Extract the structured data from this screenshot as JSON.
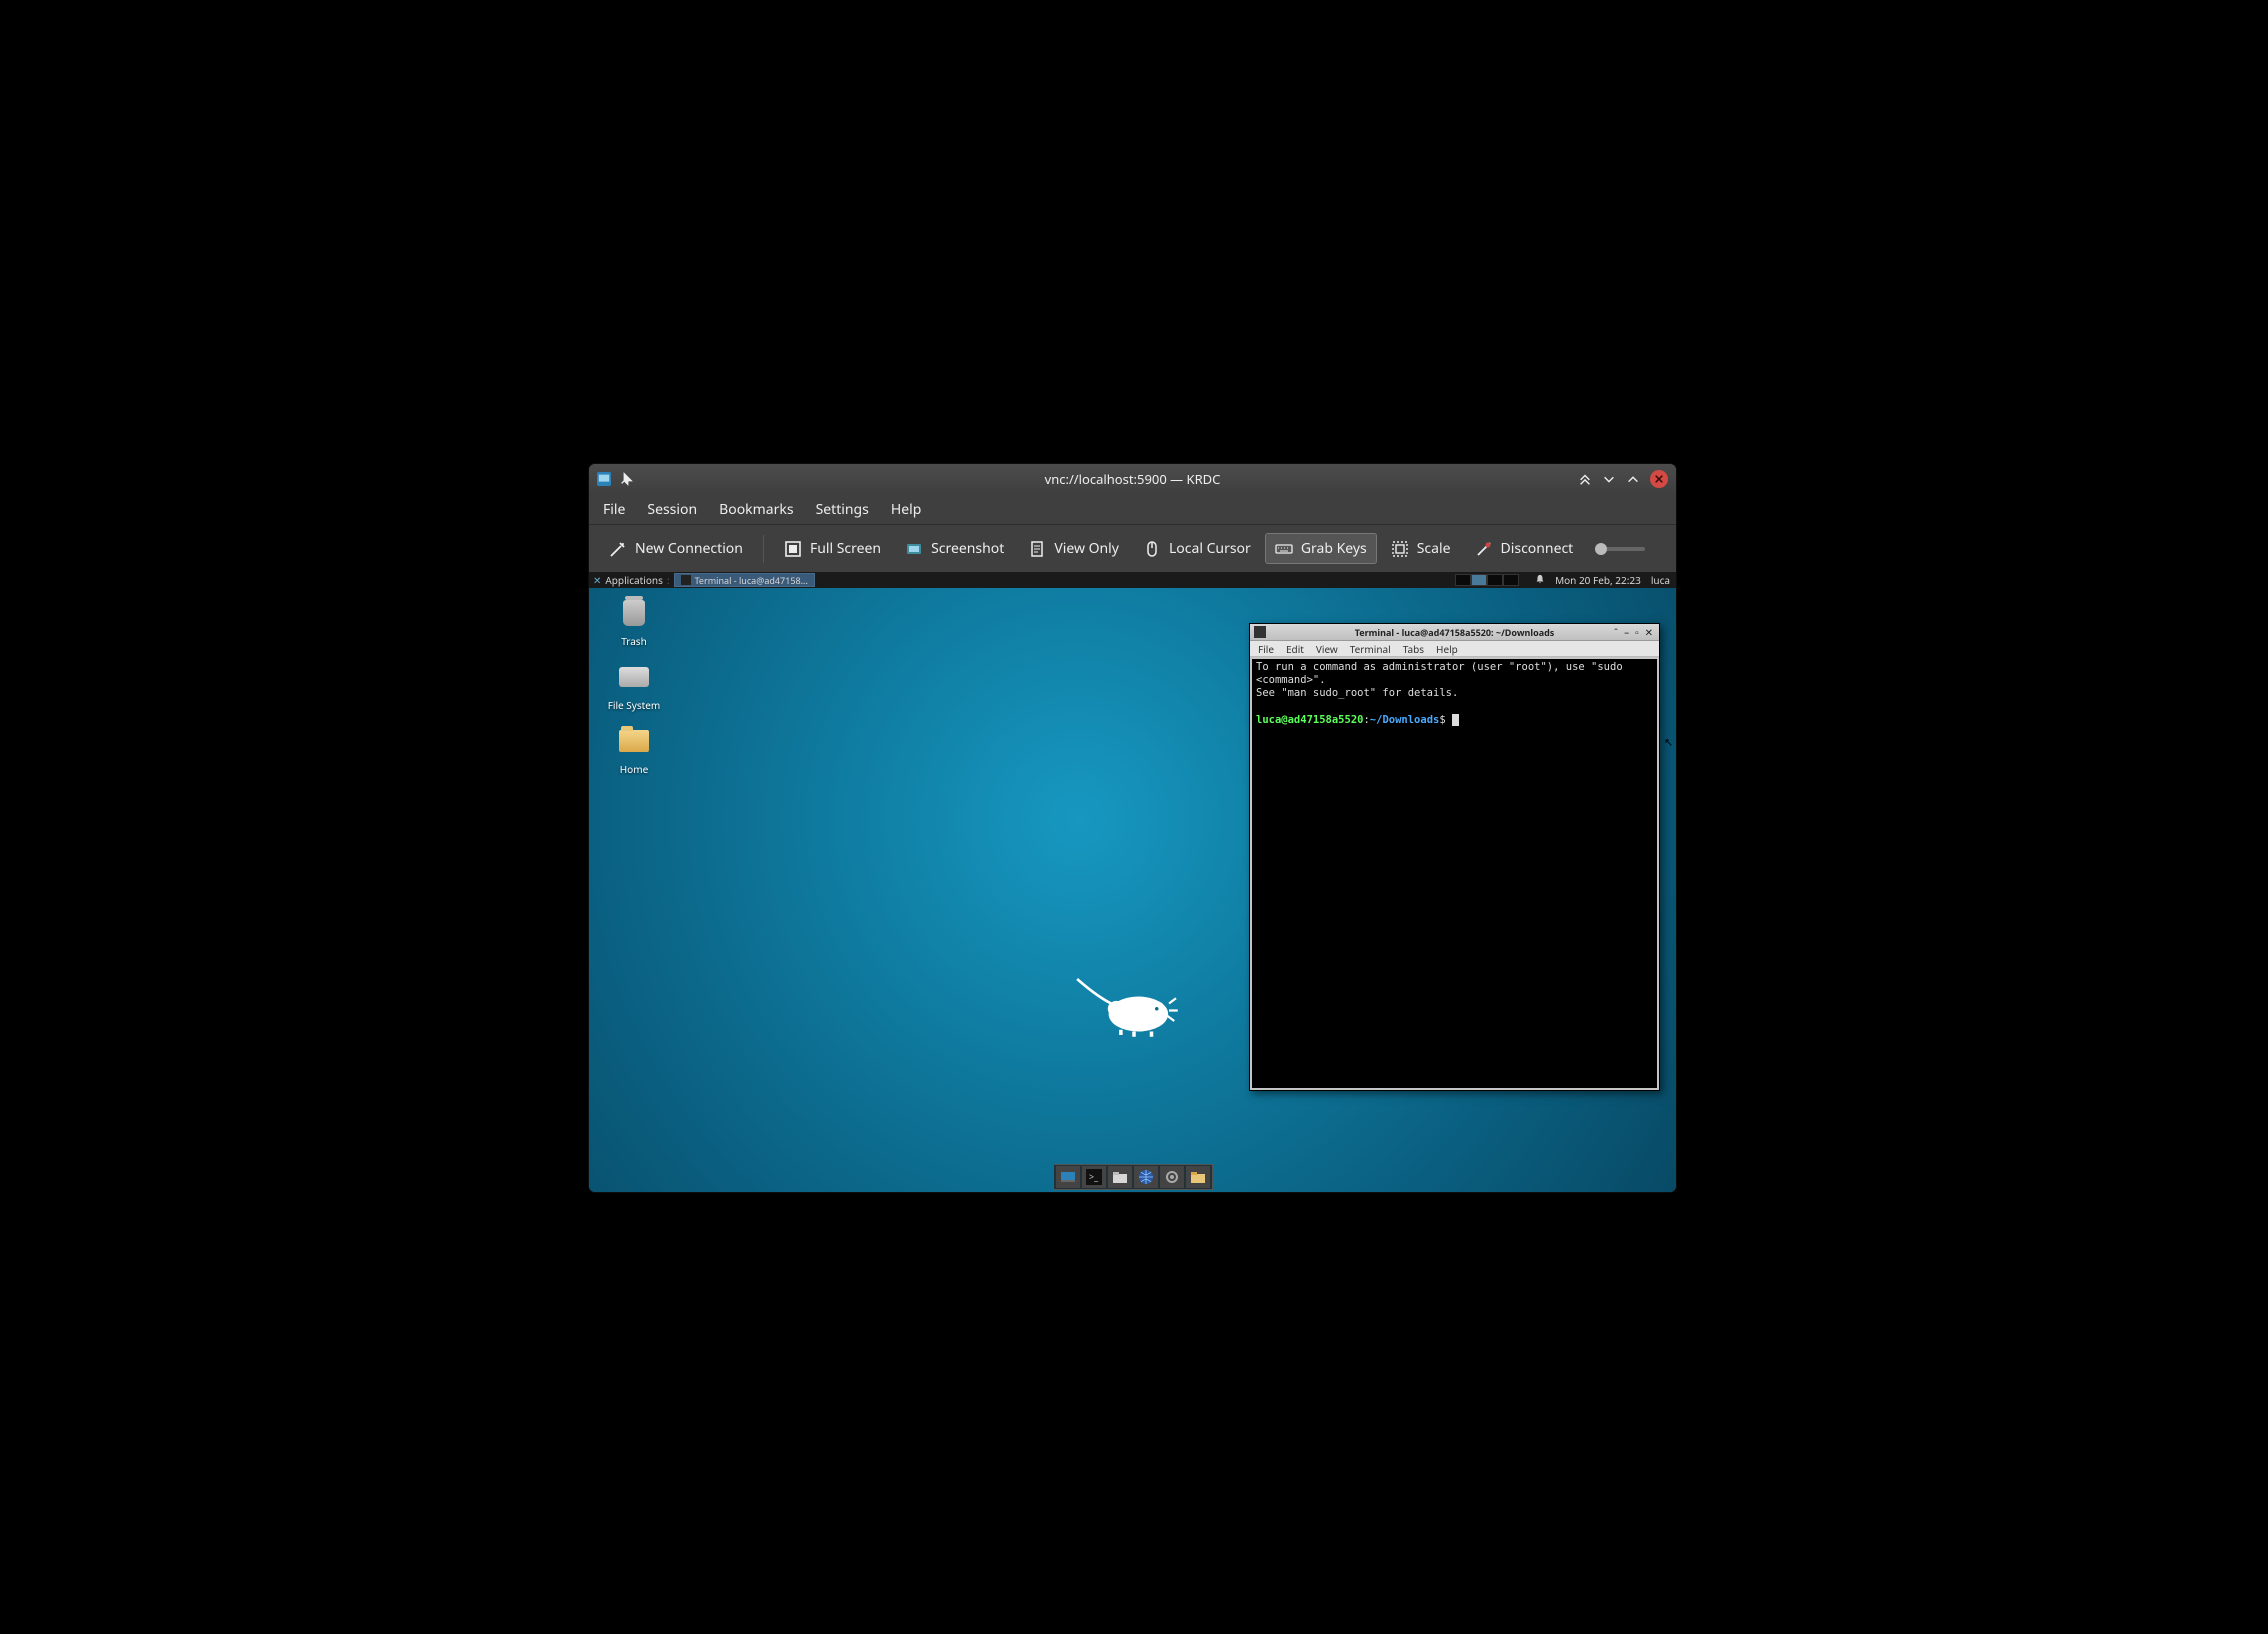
{
  "krdc": {
    "title": "vnc://localhost:5900 — KRDC",
    "menubar": [
      "File",
      "Session",
      "Bookmarks",
      "Settings",
      "Help"
    ],
    "toolbar": {
      "new_connection": "New Connection",
      "full_screen": "Full Screen",
      "screenshot": "Screenshot",
      "view_only": "View Only",
      "local_cursor": "Local Cursor",
      "grab_keys": "Grab Keys",
      "scale": "Scale",
      "disconnect": "Disconnect"
    }
  },
  "xfce": {
    "applications_label": "Applications",
    "taskbar_item": "Terminal - luca@ad47158...",
    "clock": "Mon 20 Feb, 22:23",
    "user": "luca",
    "desktop_icons": {
      "trash": "Trash",
      "filesystem": "File System",
      "home": "Home"
    }
  },
  "terminal": {
    "title": "Terminal - luca@ad47158a5520: ~/Downloads",
    "menubar": [
      "File",
      "Edit",
      "View",
      "Terminal",
      "Tabs",
      "Help"
    ],
    "motd_line1": "To run a command as administrator (user \"root\"), use \"sudo <command>\".",
    "motd_line2": "See \"man sudo_root\" for details.",
    "prompt_user": "luca@ad47158a5520",
    "prompt_sep": ":",
    "prompt_path": "~/Downloads",
    "prompt_end": "$ "
  }
}
